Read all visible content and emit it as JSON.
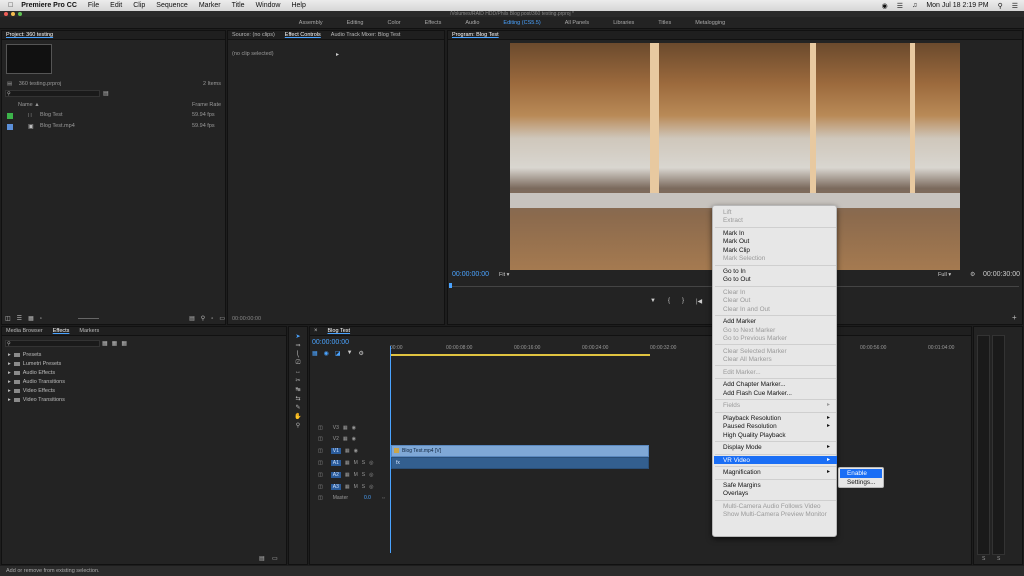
{
  "menubar": {
    "app": "Premiere Pro CC",
    "items": [
      "File",
      "Edit",
      "Clip",
      "Sequence",
      "Marker",
      "Title",
      "Window",
      "Help"
    ],
    "clock": "Mon Jul 18  2:19 PM"
  },
  "window_title": "/Volumes/RAID HDD/Phils Blog post/360 testing.prproj *",
  "workspaces": {
    "items": [
      "Assembly",
      "Editing",
      "Color",
      "Effects",
      "Audio",
      "Editing (CS5.5)",
      "All Panels",
      "Libraries",
      "Titles",
      "Metalogging"
    ],
    "active": "Editing (CS5.5)"
  },
  "project": {
    "tab": "Project: 360 testing",
    "file": "360 testing.prproj",
    "count": "2 Items",
    "col_name": "Name",
    "col_rate": "Frame Rate",
    "rows": [
      {
        "name": "Blog Test",
        "rate": "59.94 fps",
        "color": "#3cb34a"
      },
      {
        "name": "Blog Test.mp4",
        "rate": "59.94 fps",
        "color": "#5b8fd8"
      }
    ]
  },
  "source": {
    "tabs": [
      "Source: (no clips)",
      "Effect Controls",
      "Audio Track Mixer: Blog Test"
    ],
    "active_tab": "Effect Controls",
    "no_clip": "(no clip selected)",
    "timecode": "00:00:00:00"
  },
  "program": {
    "tab": "Program: Blog Test",
    "timecode": "00:00:00:00",
    "fit": "Fit",
    "quality": "Full",
    "duration": "00:00:30:00"
  },
  "effects": {
    "tabs": [
      "Media Browser",
      "Effects",
      "Markers"
    ],
    "active_tab": "Effects",
    "items": [
      "Presets",
      "Lumetri Presets",
      "Audio Effects",
      "Audio Transitions",
      "Video Effects",
      "Video Transitions"
    ]
  },
  "timeline": {
    "tab": "Blog Test",
    "timecode": "00:00:00:00",
    "ruler": [
      "00:00",
      "00:00:08:00",
      "00:00:16:00",
      "00:00:24:00",
      "00:00:32:00",
      "00:00:56:00",
      "00:01:04:00"
    ],
    "video_tracks": [
      "V3",
      "V2",
      "V1"
    ],
    "audio_tracks": [
      "A1",
      "A2",
      "A3"
    ],
    "master": "Master",
    "master_value": "0.0",
    "clip_video": "Blog Test.mp4 [V]"
  },
  "context_menu": {
    "items": [
      {
        "label": "Lift",
        "enabled": false,
        "arrow": false
      },
      {
        "label": "Extract",
        "enabled": false,
        "arrow": false
      },
      {
        "label": "Mark In",
        "enabled": true,
        "arrow": false
      },
      {
        "label": "Mark Out",
        "enabled": true,
        "arrow": false
      },
      {
        "label": "Mark Clip",
        "enabled": true,
        "arrow": false
      },
      {
        "label": "Mark Selection",
        "enabled": false,
        "arrow": false
      },
      {
        "label": "Go to In",
        "enabled": true,
        "arrow": false
      },
      {
        "label": "Go to Out",
        "enabled": true,
        "arrow": false
      },
      {
        "label": "Clear In",
        "enabled": false,
        "arrow": false
      },
      {
        "label": "Clear Out",
        "enabled": false,
        "arrow": false
      },
      {
        "label": "Clear In and Out",
        "enabled": false,
        "arrow": false
      },
      {
        "label": "Add Marker",
        "enabled": true,
        "arrow": false
      },
      {
        "label": "Go to Next Marker",
        "enabled": false,
        "arrow": false
      },
      {
        "label": "Go to Previous Marker",
        "enabled": false,
        "arrow": false
      },
      {
        "label": "Clear Selected Marker",
        "enabled": false,
        "arrow": false
      },
      {
        "label": "Clear All Markers",
        "enabled": false,
        "arrow": false
      },
      {
        "label": "Edit Marker...",
        "enabled": false,
        "arrow": false
      },
      {
        "label": "Add Chapter Marker...",
        "enabled": true,
        "arrow": false
      },
      {
        "label": "Add Flash Cue Marker...",
        "enabled": true,
        "arrow": false
      },
      {
        "label": "Fields",
        "enabled": false,
        "arrow": true
      },
      {
        "label": "Playback Resolution",
        "enabled": true,
        "arrow": true
      },
      {
        "label": "Paused Resolution",
        "enabled": true,
        "arrow": true
      },
      {
        "label": "High Quality Playback",
        "enabled": true,
        "arrow": false
      },
      {
        "label": "Display Mode",
        "enabled": true,
        "arrow": true
      },
      {
        "label": "VR Video",
        "enabled": true,
        "arrow": true
      },
      {
        "label": "Magnification",
        "enabled": true,
        "arrow": true
      },
      {
        "label": "Safe Margins",
        "enabled": true,
        "arrow": false
      },
      {
        "label": "Overlays",
        "enabled": true,
        "arrow": false
      },
      {
        "label": "Multi-Camera Audio Follows Video",
        "enabled": false,
        "arrow": false
      },
      {
        "label": "Show Multi-Camera Preview Monitor",
        "enabled": false,
        "arrow": false
      }
    ],
    "highlighted": "VR Video",
    "submenu": [
      "Enable",
      "Settings..."
    ]
  },
  "status_bar": "Add or remove from existing selection.",
  "meter_labels": [
    "S",
    "S"
  ],
  "colors": {
    "accent": "#4aa3ff",
    "highlight": "#1a6ef5"
  }
}
